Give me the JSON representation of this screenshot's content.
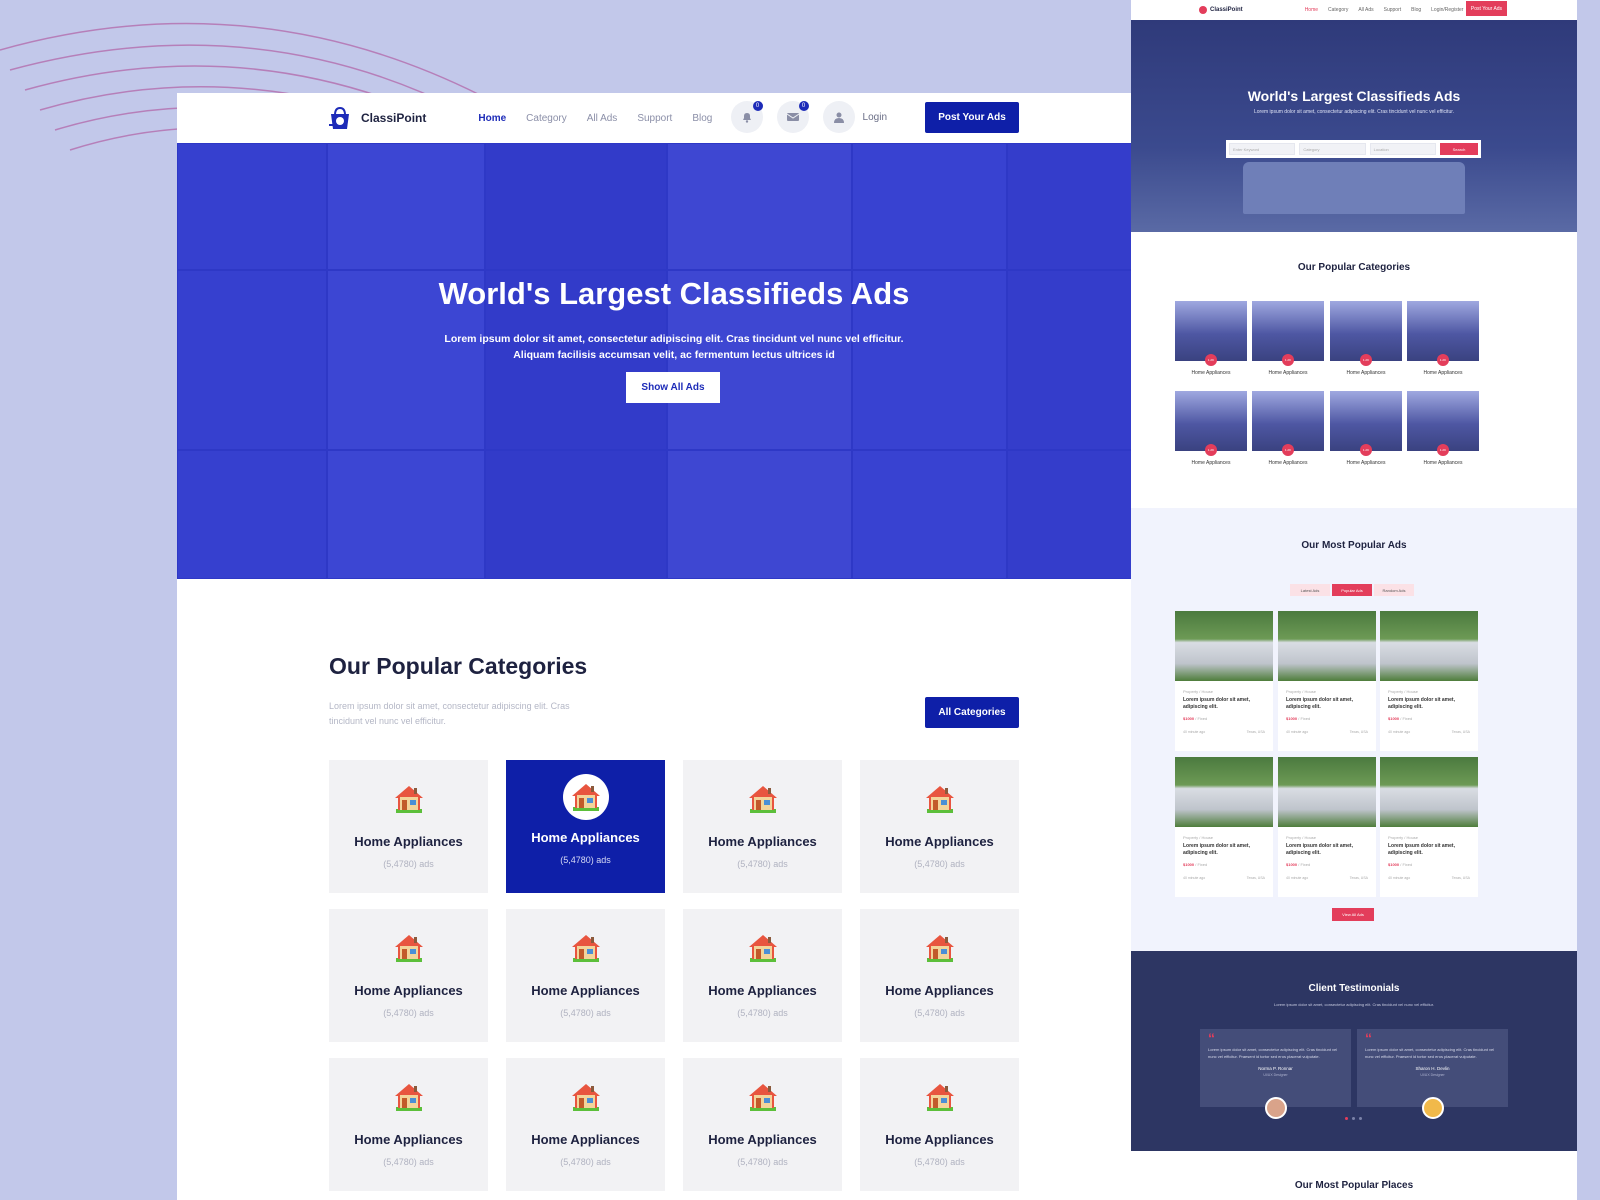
{
  "colors": {
    "primary": "#0e1fa8",
    "accent_red": "#e33d5b",
    "background": "#c2c8ea"
  },
  "main": {
    "brand": "ClassiPoint",
    "nav": [
      "Home",
      "Category",
      "All Ads",
      "Support",
      "Blog"
    ],
    "nav_active": "Home",
    "notifications_count": "0",
    "messages_count": "0",
    "login": "Login",
    "post_button": "Post Your Ads",
    "hero": {
      "title": "World's Largest Classifieds Ads",
      "subtitle_line1": "Lorem ipsum dolor sit amet, consectetur adipiscing elit. Cras tincidunt vel nunc vel efficitur.",
      "subtitle_line2": "Aliquam facilisis accumsan velit, ac fermentum lectus ultrices id",
      "button": "Show All Ads"
    },
    "categories": {
      "title": "Our Popular Categories",
      "description": "Lorem ipsum dolor sit amet, consectetur adipiscing elit. Cras tincidunt vel nunc vel efficitur.",
      "all_button": "All Categories",
      "items": [
        {
          "name": "Home Appliances",
          "count": "(5,4780) ads",
          "selected": false
        },
        {
          "name": "Home Appliances",
          "count": "(5,4780) ads",
          "selected": true
        },
        {
          "name": "Home Appliances",
          "count": "(5,4780) ads",
          "selected": false
        },
        {
          "name": "Home Appliances",
          "count": "(5,4780) ads",
          "selected": false
        },
        {
          "name": "Home Appliances",
          "count": "(5,4780) ads",
          "selected": false
        },
        {
          "name": "Home Appliances",
          "count": "(5,4780) ads",
          "selected": false
        },
        {
          "name": "Home Appliances",
          "count": "(5,4780) ads",
          "selected": false
        },
        {
          "name": "Home Appliances",
          "count": "(5,4780) ads",
          "selected": false
        },
        {
          "name": "Home Appliances",
          "count": "(5,4780) ads",
          "selected": false
        },
        {
          "name": "Home Appliances",
          "count": "(5,4780) ads",
          "selected": false
        },
        {
          "name": "Home Appliances",
          "count": "(5,4780) ads",
          "selected": false
        },
        {
          "name": "Home Appliances",
          "count": "(5,4780) ads",
          "selected": false
        }
      ]
    }
  },
  "preview": {
    "brand": "ClassiPoint",
    "nav": [
      "Home",
      "Category",
      "All Ads",
      "Support",
      "Blog",
      "Login/Register"
    ],
    "post_button": "Post Your Ads",
    "hero_title": "World's Largest Classifieds Ads",
    "hero_sub": "Lorem ipsum dolor sit amet, consectetur adipiscing elit. Cras tincidunt vel nunc vel efficitur.",
    "search_fields": [
      "Enter Keyword",
      "Category",
      "Location"
    ],
    "search_button": "Search",
    "categories_title": "Our Popular Categories",
    "categories_sub": "Lorem ipsum dolor sit amet, consectetur adipiscing elit. Cras tincidunt vel nunc vel efficitur.",
    "category_label": "Home Appliances",
    "category_badge": "1.2K",
    "ads_title": "Our Most Popular Ads",
    "tabs": [
      "Latest Ads",
      "Popular Ads",
      "Random Ads"
    ],
    "ad": {
      "category": "Property / House",
      "title": "Lorem ipsum dolor sit amet, adipiscing elit.",
      "price": "$1000",
      "price_suffix": " / Fixed",
      "time": "40 minute ago",
      "location": "Texas, USA"
    },
    "view_all": "View All Ads",
    "testimonials_title": "Client Testimonials",
    "testimonials_sub": "Lorem ipsum dolor sit amet, consectetur adipiscing elit. Cras tincidunt vel nunc vel efficitur.",
    "testimonials": [
      {
        "text": "Lorem ipsum dolor sit amet, consectetur adipiscing elit. Cras tincidunt vel nunc vel efficitur. Praesent id tortor sed eros placerat vulputate.",
        "name": "Norma P. Ronnar",
        "role": "UI/UX Designer"
      },
      {
        "text": "Lorem ipsum dolor sit amet, consectetur adipiscing elit. Cras tincidunt vel nunc vel efficitur. Praesent id tortor sed eros placerat vulputate.",
        "name": "Sharon H. Devlin",
        "role": "UI/UX Designer"
      }
    ],
    "places_title": "Our Most Popular Places"
  }
}
